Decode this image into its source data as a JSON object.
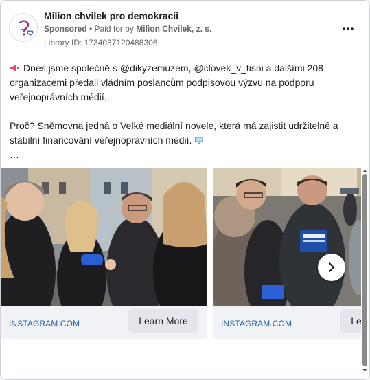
{
  "post": {
    "page_name": "Milion chvilek pro demokracii",
    "sponsored_label": "Sponsored",
    "separator": " • ",
    "paid_for_label": "Paid for by ",
    "payer": "Milion Chvilek, z. s.",
    "library_id": "Library ID: 1734037120488306",
    "paragraph_1": "Dnes jsme společně s @dikyzemuzem, @clovek_v_tisni a dalšími 208 organizacemi předali vládním poslancům podpisovou výzvu na podporu veřejnoprávních médií.",
    "paragraph_2": "Proč? Sněmovna jedná o Velké mediální novele, která má zajistit udržitelné a stabilní financování veřejnoprávních médií.",
    "ellipsis": "…"
  },
  "carousel": {
    "slides": [
      {
        "domain": "INSTAGRAM.COM",
        "cta": "Learn More"
      },
      {
        "domain": "INSTAGRAM.COM",
        "cta": "Learn More"
      }
    ]
  },
  "icons": {
    "more": "more-horizontal-icon",
    "megaphone": "megaphone-icon",
    "tv": "television-icon",
    "next": "chevron-right-icon"
  },
  "colors": {
    "link": "#1c5fb0",
    "muted": "#65676b",
    "button_bg": "#e4e6eb"
  }
}
